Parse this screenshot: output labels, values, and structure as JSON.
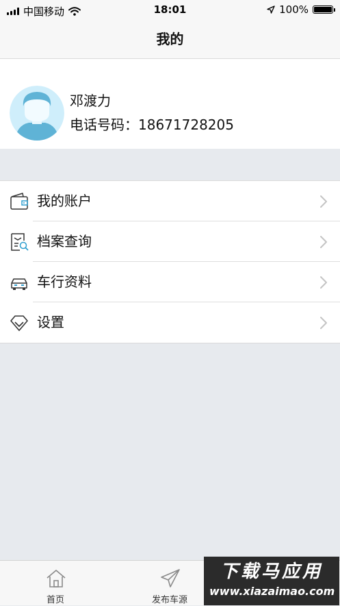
{
  "status_bar": {
    "carrier": "中国移动",
    "time": "18:01",
    "battery_text": "100%",
    "battery_level": 1.0
  },
  "nav": {
    "title": "我的"
  },
  "profile": {
    "name": "邓渡力",
    "phone_label": "电话号码：",
    "phone_number": "18671728205"
  },
  "menu": {
    "items": [
      {
        "label": "我的账户",
        "icon": "wallet-icon"
      },
      {
        "label": "档案查询",
        "icon": "file-search-icon"
      },
      {
        "label": "车行资料",
        "icon": "car-icon"
      },
      {
        "label": "设置",
        "icon": "diamond-icon"
      }
    ]
  },
  "tabbar": {
    "tabs": [
      {
        "label": "首页",
        "icon": "home-icon"
      },
      {
        "label": "发布车源",
        "icon": "send-icon"
      }
    ]
  },
  "watermark": {
    "main": "下载马应用",
    "url": "www.xiazaimao.com"
  },
  "colors": {
    "accent": "#2f9fd0",
    "avatar_bg": "#cfeefb",
    "divider": "#dedede",
    "background": "#e7eaee"
  }
}
